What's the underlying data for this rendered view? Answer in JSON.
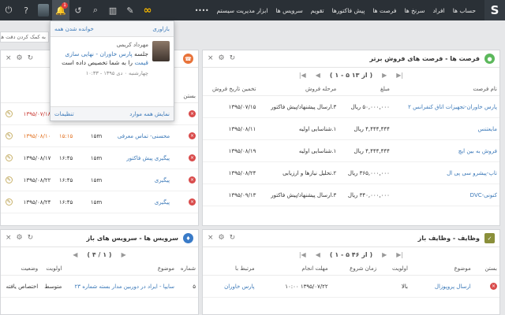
{
  "topbar": {
    "logo": "S",
    "menu": [
      "حساب ها",
      "افراد",
      "سرنخ ها",
      "فرصت ها",
      "پیش فاکتورها",
      "تقویم",
      "سرویس ها",
      "ابزار مدیریت سیستم",
      "••••"
    ],
    "notification_count": "1"
  },
  "search_hint": "به کمک کردن دقت های سرچ",
  "opportunities": {
    "title": "فرصت ها - فرصت های فروش برتر",
    "pager": "( ۱ - ۵ از ۱۳ )",
    "columns": [
      "نام فرصت",
      "مبلغ",
      "مرحله فروش",
      "تخمین تاریخ فروش"
    ],
    "rows": [
      {
        "name": "پارس خاوران-تجهیزات اتاق کنفرانس ۲",
        "amount": "۵۰,۰۰۰,۰۰۰ ریال",
        "stage": "۳.ارسال پیشنهاد/پیش فاکتور",
        "date": "۱۳۹۵/۰۷/۱۵"
      },
      {
        "name": "مایعتنس",
        "amount": "۴,۴۴۴,۴۴۴ ریال",
        "stage": "۱.شناسایی اولیه",
        "date": "۱۳۹۵/۰۸/۱۱"
      },
      {
        "name": "فروش به بین ایچ",
        "amount": "۴,۴۴۴,۴۴۴ ریال",
        "stage": "۱.شناسایی اولیه",
        "date": "۱۳۹۵/۰۸/۱۹"
      },
      {
        "name": "تاپ-پیشرو سی پی ال",
        "amount": "۳۶۵,۰۰۰,۰۰۰ ریال",
        "stage": "۲.تحلیل نیازها و ارزیابی",
        "date": "۱۳۹۵/۰۸/۲۴"
      },
      {
        "name": "کنونی-DVC",
        "amount": "۳۴۰,۰۰۰,۰۰۰ ریال",
        "stage": "۳.ارسال پیشنهاد/پیش فاکتور",
        "date": "۱۳۹۵/۰۹/۱۳"
      }
    ]
  },
  "calls": {
    "columns": [
      "بستن",
      "",
      "",
      ""
    ],
    "rows": [
      {
        "date": "۱۳۹۵/۰۷/۱۸",
        "time": "",
        "duration": "۱ ساعت",
        "subject": "",
        "date_style": "red"
      },
      {
        "date": "۱۳۹۵/۰۸/۱۰",
        "time": "۱۵:۱۵",
        "duration": "۱۵m",
        "subject": "محسنی- تماس معرفی",
        "date_style": "orange"
      },
      {
        "date": "۱۳۹۵/۰۸/۱۷",
        "time": "۱۶:۴۵",
        "duration": "۱۵m",
        "subject": "پیگیری پیش فاکتور",
        "date_style": ""
      },
      {
        "date": "۱۳۹۵/۰۸/۲۲",
        "time": "۱۶:۴۵",
        "duration": "۱۵m",
        "subject": "پیگیری",
        "date_style": ""
      },
      {
        "date": "۱۳۹۵/۰۸/۲۴",
        "time": "۱۶:۴۵",
        "duration": "۱۵m",
        "subject": "پیگیری",
        "date_style": ""
      }
    ]
  },
  "tasks": {
    "title": "وظایف - وظایف باز",
    "pager": "( ۱ - ۵ از ۴۶ )",
    "columns": [
      "بستن",
      "موضوع",
      "اولویت",
      "زمان شروع",
      "مهلت انجام",
      "مرتبط با"
    ],
    "rows": [
      {
        "subject": "ارسال پروپوزال",
        "priority": "بالا",
        "start": "",
        "due": "۱۳۹۵/۰۷/۲۲ ۱۰:۰۰",
        "related": "پارس خاوران"
      }
    ]
  },
  "services": {
    "title": "سرویس ها - سرویس های باز",
    "pager": "( ۴ / ۱ )",
    "columns": [
      "شماره",
      "موضوع",
      "اولویت",
      "وضعیت"
    ],
    "rows": [
      {
        "number": "۵",
        "subject": "سایپا - ایراد در دوربین مدار بسته شماره ۲۳",
        "priority": "متوسط",
        "status": "اختصاص یافته"
      }
    ]
  },
  "notification": {
    "header_left": "خوانده شدن همه",
    "header_right": "بازاوری",
    "user": "مهرداد کریمی",
    "text_prefix": "جلسه",
    "link1": "پارس خاوران - نهایی",
    "link2": "سازی قیمت",
    "text_suffix": "را به شما تخصیص داده است",
    "time": "چهارشنبه ۰ دی ۱۳۹۵ - ۱۰:۳۳",
    "footer_right": "نمایش همه موارد",
    "footer_left": "تنظیمات"
  },
  "colors": {
    "topbar": "#2a3036",
    "link": "#3a78b8",
    "badge": "#e23b3b"
  }
}
